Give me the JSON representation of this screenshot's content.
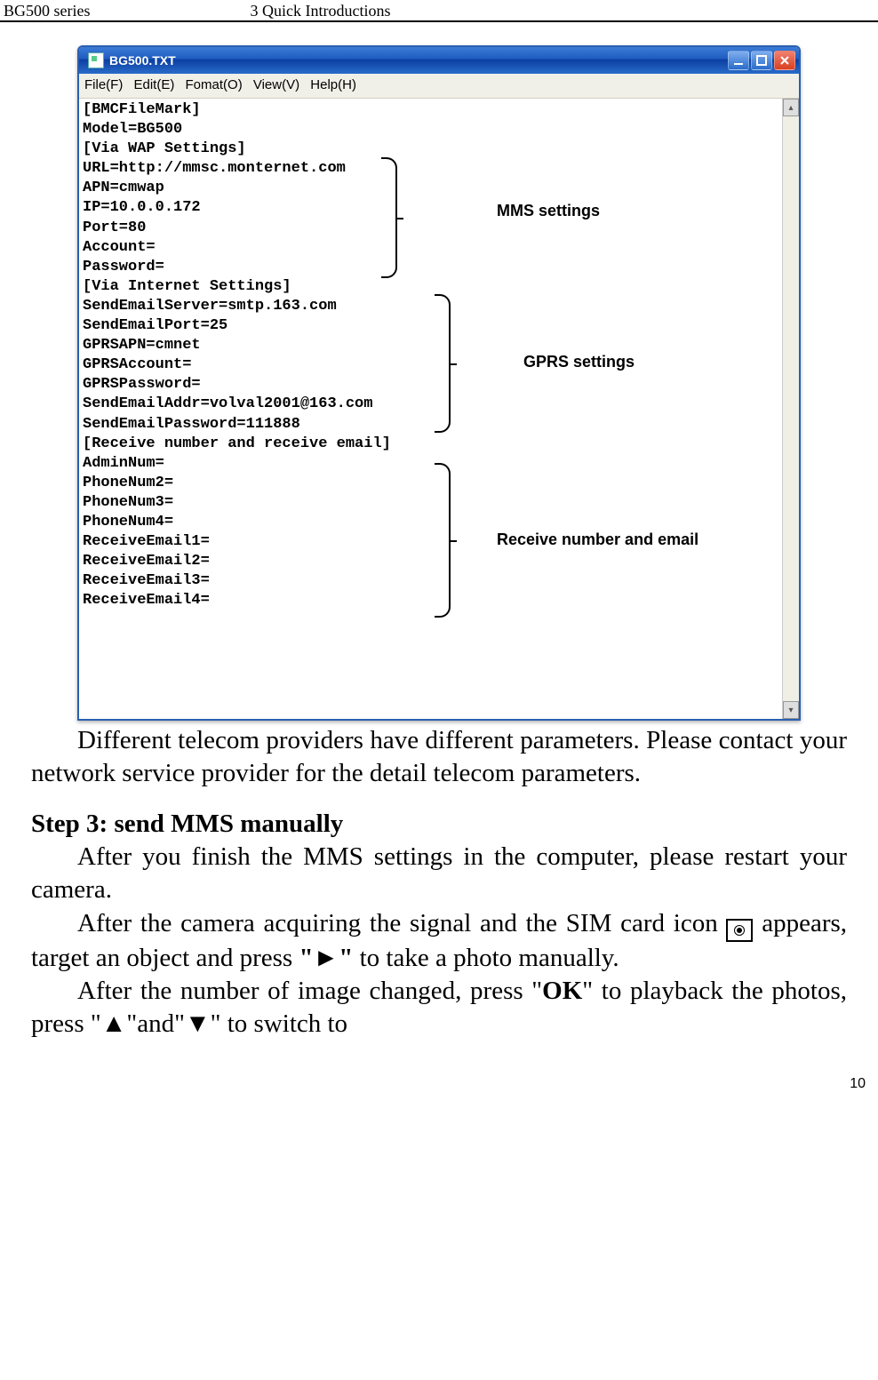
{
  "page": {
    "header_left": "BG500 series",
    "header_center": "3 Quick Introductions",
    "number": "10"
  },
  "window": {
    "title": "BG500.TXT",
    "menu": {
      "file": "File(F)",
      "edit": "Edit(E)",
      "format": "Fomat(O)",
      "view": "View(V)",
      "help": "Help(H)"
    }
  },
  "editor": {
    "lines": "[BMCFileMark]\nModel=BG500\n[Via WAP Settings]\nURL=http://mmsc.monternet.com\nAPN=cmwap\nIP=10.0.0.172\nPort=80\nAccount=\nPassword=\n[Via Internet Settings]\nSendEmailServer=smtp.163.com\nSendEmailPort=25\nGPRSAPN=cmnet\nGPRSAccount=\nGPRSPassword=\nSendEmailAddr=volval2001@163.com\nSendEmailPassword=111888\n[Receive number and receive email]\nAdminNum=\nPhoneNum2=\nPhoneNum3=\nPhoneNum4=\nReceiveEmail1=\nReceiveEmail2=\nReceiveEmail3=\nReceiveEmail4="
  },
  "labels": {
    "mms": "MMS settings",
    "gprs": "GPRS settings",
    "recv": "Receive number and email"
  },
  "body": {
    "para1": "Different telecom providers have different parameters. Please contact your network service provider for the detail telecom parameters.",
    "step_title": "Step 3: send MMS manually",
    "para2": "After you finish the MMS settings in the computer, please restart your camera.",
    "para3a": "After the camera acquiring the signal and the SIM card icon ",
    "para3b": " appears, target an object and press ",
    "para3c": "\"►\"",
    "para3d": " to take a photo manually.",
    "para4a": "After the number of image changed, press \"",
    "para4b": "OK",
    "para4c": "\" to playback the photos, press \"▲\"and\"▼\" to switch to"
  }
}
